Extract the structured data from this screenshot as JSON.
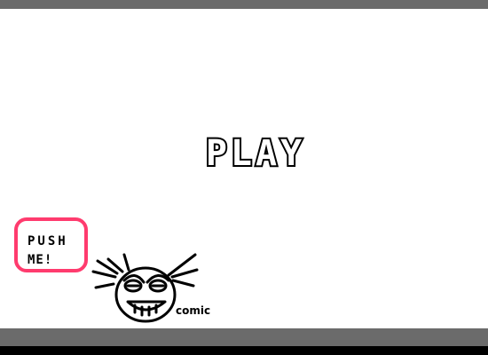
{
  "play_button": {
    "label": "PLAY"
  },
  "push_button": {
    "line1": "PUSH",
    "line2": "ME!"
  },
  "mascot": {
    "caption": "comic",
    "icon": "cartoon-face-icon"
  },
  "colors": {
    "frame_bar": "#6b6b6b",
    "push_border": "#ff3b6e",
    "background": "#ffffff"
  }
}
